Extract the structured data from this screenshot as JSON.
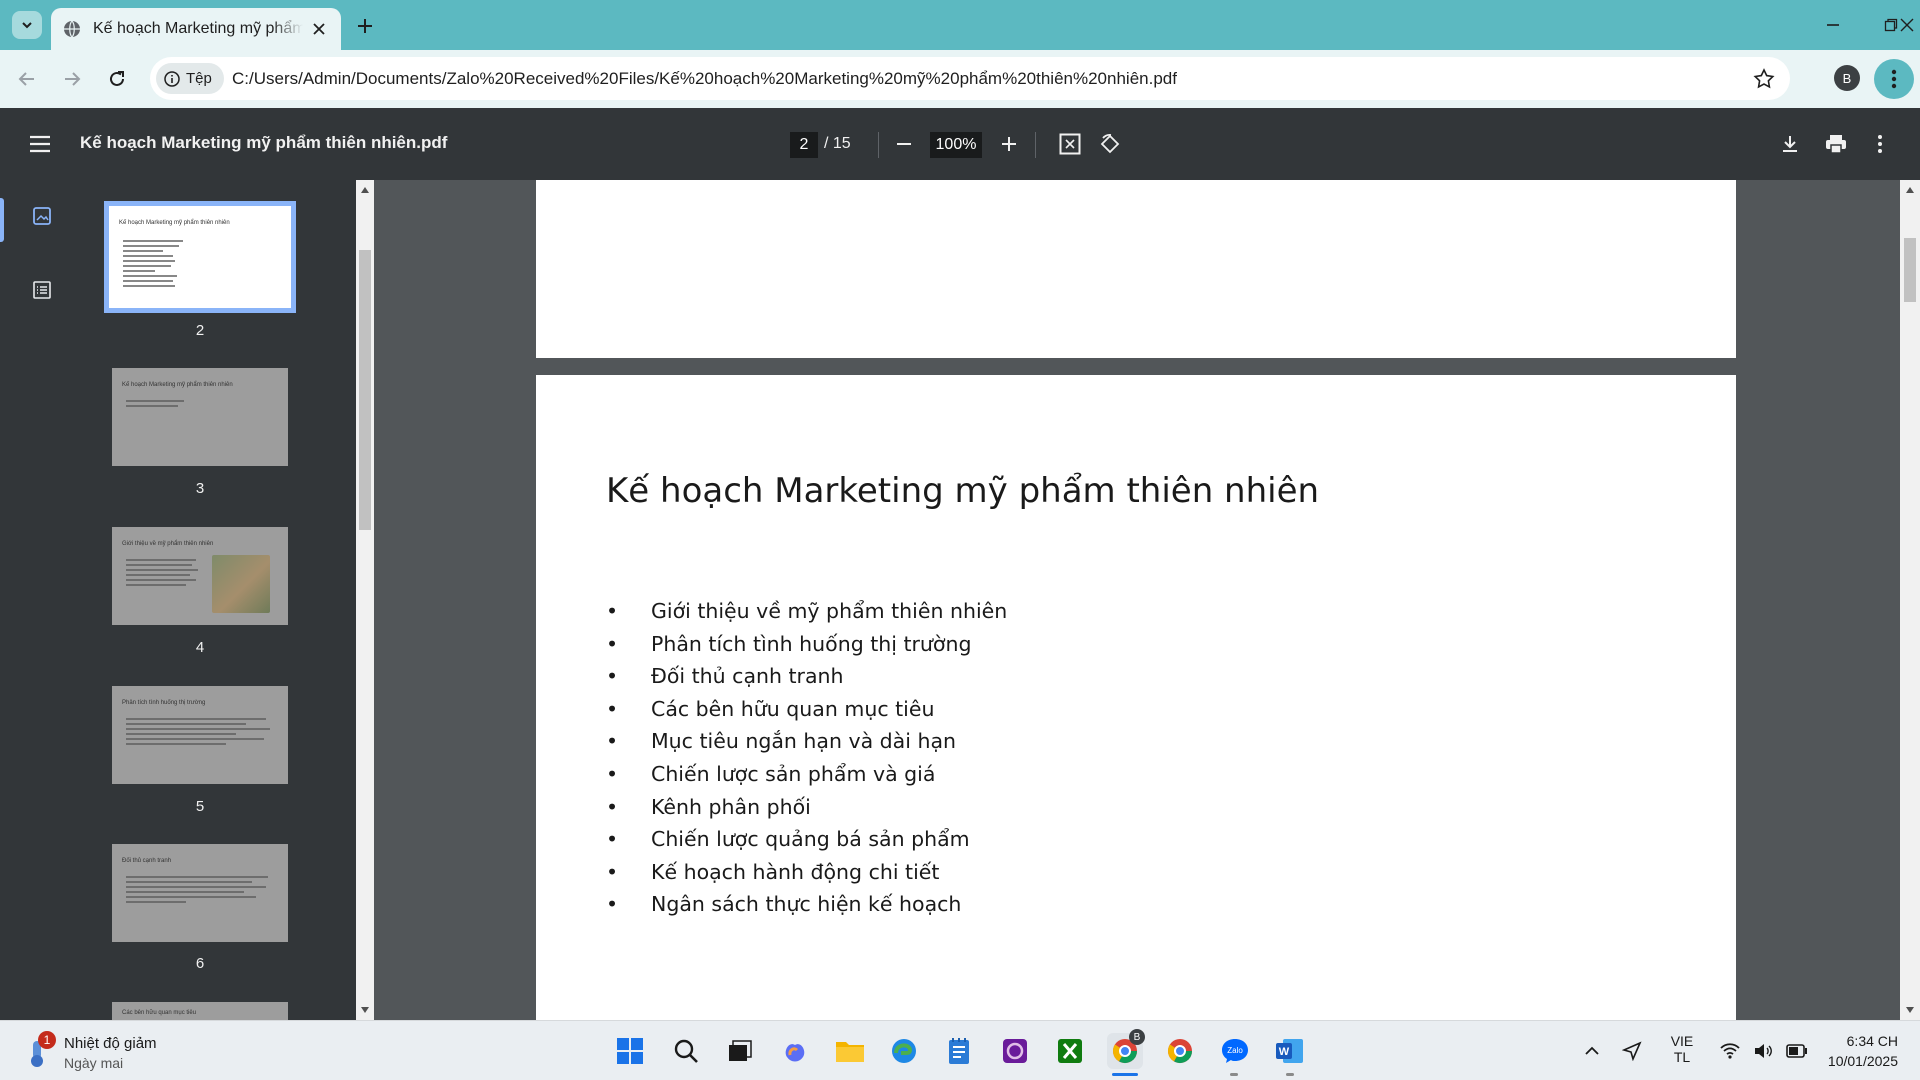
{
  "browser": {
    "tab_title": "Kế hoạch Marketing mỹ phẩm t",
    "site_chip": "Tệp",
    "url": "C:/Users/Admin/Documents/Zalo%20Received%20Files/Kế%20hoạch%20Marketing%20mỹ%20phẩm%20thiên%20nhiên.pdf",
    "profile_initial": "B"
  },
  "pdf": {
    "file_name": "Kế hoạch Marketing mỹ phẩm thiên nhiên.pdf",
    "current_page": "2",
    "total_pages": "/ 15",
    "zoom": "100%"
  },
  "thumbnails": [
    {
      "num": "2",
      "title": "Kế hoạch Marketing mỹ phẩm thiên nhiên"
    },
    {
      "num": "3",
      "title": "Kế hoạch Marketing mỹ phẩm thiên nhiên"
    },
    {
      "num": "4",
      "title": "Giới thiệu về mỹ phẩm thiên nhiên"
    },
    {
      "num": "5",
      "title": "Phân tích tình huống thị trường"
    },
    {
      "num": "6",
      "title": "Đối thủ cạnh tranh"
    },
    {
      "num": "",
      "title": "Các bên hữu quan mục tiêu"
    }
  ],
  "slide": {
    "title": "Kế hoạch Marketing mỹ phẩm thiên nhiên",
    "bullets": [
      "Giới thiệu về mỹ phẩm thiên nhiên",
      "Phân tích tình huống thị trường",
      "Đối thủ cạnh tranh",
      "Các bên hữu quan mục tiêu",
      "Mục tiêu ngắn hạn và dài hạn",
      "Chiến lược sản phẩm và giá",
      "Kênh phân phối",
      "Chiến lược quảng bá sản phẩm",
      "Kế hoạch hành động chi tiết",
      "Ngân sách thực hiện kế hoạch"
    ]
  },
  "taskbar": {
    "weather_badge": "1",
    "weather_title": "Nhiệt độ giảm",
    "weather_sub": "Ngày mai",
    "chrome_badge": "B",
    "lang_top": "VIE",
    "lang_bottom": "TL",
    "time": "6:34 CH",
    "date": "10/01/2025"
  },
  "colors": {
    "tabbar": "#5cb9c1",
    "toolbar": "#e9f4f5",
    "pdf_toolbar": "#323639",
    "doc_bg": "#525659",
    "thumb_selected": "#8ab4f8"
  }
}
